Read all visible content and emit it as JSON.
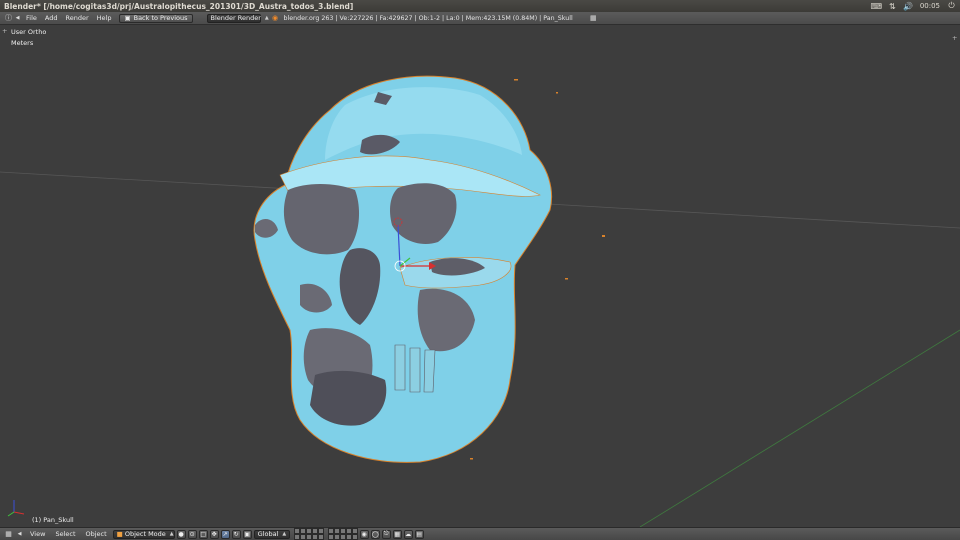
{
  "window": {
    "title": "Blender* [/home/cogitas3d/prj/Australopithecus_201301/3D_Austra_todos_3.blend]",
    "clock": "00:05"
  },
  "infobar": {
    "menus": [
      "File",
      "Add",
      "Render",
      "Help"
    ],
    "back_button": "Back to Previous",
    "render_engine": "Blender Render",
    "stats": "blender.org 263 | Ve:227226 | Fa:429627 | Ob:1-2 | La:0 | Mem:423.15M (0.84M) | Pan_Skull"
  },
  "viewport": {
    "view_name": "User Ortho",
    "units": "Meters",
    "object_label": "(1) Pan_Skull",
    "mesh_color": "#7fd0e8",
    "background": "#3d3d3d"
  },
  "bottombar": {
    "menus": [
      "View",
      "Select",
      "Object"
    ],
    "mode": "Object Mode",
    "orientation": "Global"
  }
}
